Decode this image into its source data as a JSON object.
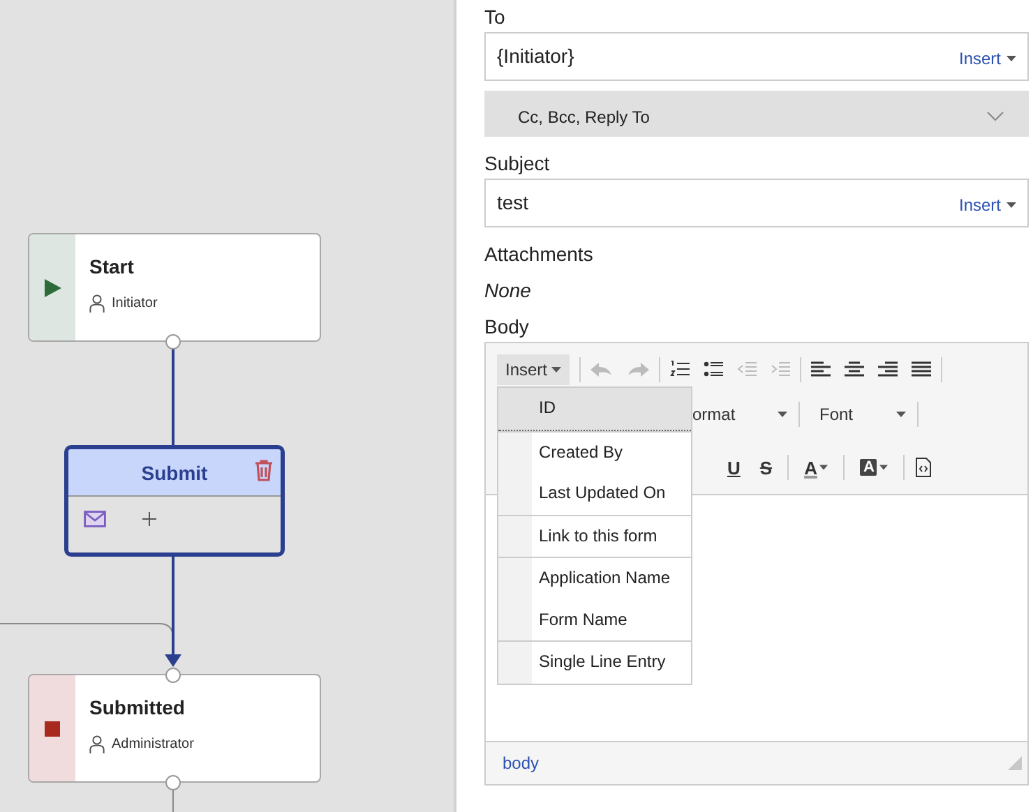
{
  "canvas": {
    "nodes": [
      {
        "kind": "start",
        "title": "Start",
        "role": "Initiator"
      },
      {
        "kind": "step",
        "title": "Submit",
        "selected": true
      },
      {
        "kind": "end",
        "title": "Submitted",
        "role": "Administrator"
      }
    ]
  },
  "panel": {
    "to": {
      "label": "To",
      "value": "{Initiator}",
      "insert": "Insert"
    },
    "cc": {
      "label": "Cc, Bcc, Reply To",
      "expanded": false
    },
    "subject": {
      "label": "Subject",
      "value": "test",
      "insert": "Insert"
    },
    "attachments": {
      "label": "Attachments",
      "value": "None"
    },
    "body": {
      "label": "Body",
      "insert": {
        "label": "Insert",
        "expanded": true
      },
      "format_dropdown": "ormat",
      "font_dropdown": "Font",
      "text_buttons": [
        {
          "kind": "underline",
          "label": "U"
        },
        {
          "kind": "strike",
          "label": "S"
        },
        {
          "kind": "color",
          "label": "A"
        },
        {
          "kind": "background",
          "label": "A"
        }
      ],
      "menu": {
        "groups": [
          [
            {
              "label": "ID",
              "selected": true
            }
          ],
          [
            {
              "label": "Created By",
              "selected": false
            },
            {
              "label": "Last Updated On",
              "selected": false
            }
          ],
          [
            {
              "label": "Link to this form",
              "selected": false
            }
          ],
          [
            {
              "label": "Application Name",
              "selected": false
            },
            {
              "label": "Form Name",
              "selected": false
            }
          ],
          [
            {
              "label": "Single Line Entry",
              "selected": false
            }
          ]
        ]
      },
      "status": "body"
    }
  }
}
